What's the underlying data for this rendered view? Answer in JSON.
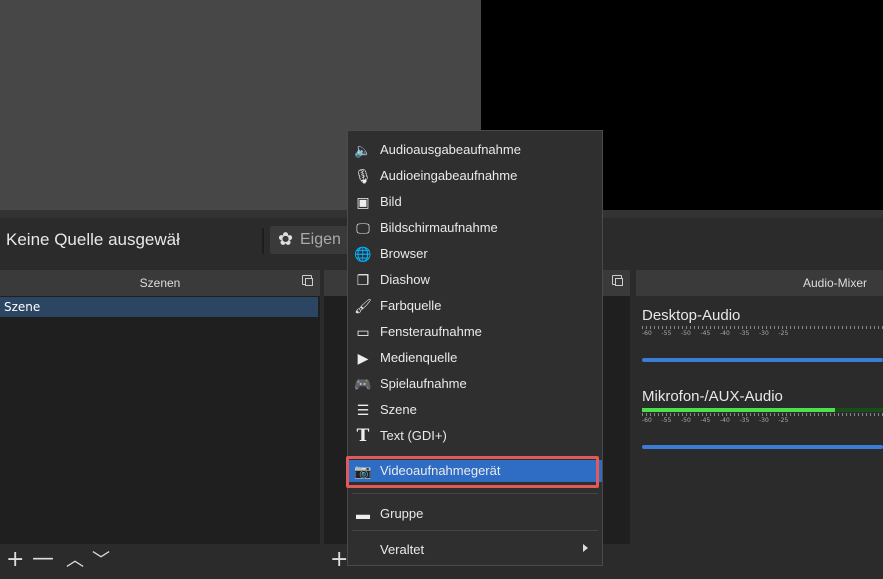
{
  "source_bar": {
    "no_source_text": "Keine Quelle ausgewäł",
    "properties_label": "Eigen"
  },
  "scenes": {
    "title": "Szenen",
    "items": [
      "Szene"
    ]
  },
  "mixer": {
    "title": "Audio-Mixer",
    "scale": [
      "-60",
      "-55",
      "-50",
      "-45",
      "-40",
      "-35",
      "-30",
      "-25"
    ],
    "channels": [
      {
        "name": "Desktop-Audio",
        "level": 0.0
      },
      {
        "name": "Mikrofon-/AUX-Audio",
        "level": 0.8
      }
    ]
  },
  "menu": {
    "items": [
      {
        "label": "Audioausgabeaufnahme",
        "icon": "speaker-icon"
      },
      {
        "label": "Audioeingabeaufnahme",
        "icon": "microphone-icon"
      },
      {
        "label": "Bild",
        "icon": "image-icon"
      },
      {
        "label": "Bildschirmaufnahme",
        "icon": "monitor-icon"
      },
      {
        "label": "Browser",
        "icon": "globe-icon"
      },
      {
        "label": "Diashow",
        "icon": "slideshow-icon"
      },
      {
        "label": "Farbquelle",
        "icon": "brush-icon"
      },
      {
        "label": "Fensteraufnahme",
        "icon": "window-icon"
      },
      {
        "label": "Medienquelle",
        "icon": "play-icon"
      },
      {
        "label": "Spielaufnahme",
        "icon": "gamepad-icon"
      },
      {
        "label": "Szene",
        "icon": "list-icon"
      },
      {
        "label": "Text (GDI+)",
        "icon": "text-icon"
      },
      {
        "label": "Videoaufnahmegerät",
        "icon": "camera-icon",
        "selected": true
      }
    ],
    "group_label": "Gruppe",
    "deprecated_label": "Veraltet"
  },
  "colors": {
    "selection": "#2f6cc4",
    "highlight_border": "#e05a5a",
    "meter_green": "#4de04d",
    "volume_blue": "#3b7cd6"
  }
}
